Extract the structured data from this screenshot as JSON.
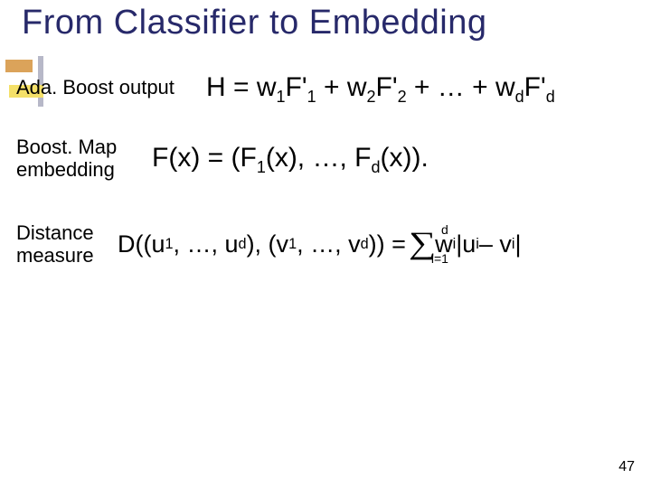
{
  "slide": {
    "title": "From Classifier to Embedding",
    "page_number": "47"
  },
  "rows": {
    "adaboost": {
      "label": "Ada. Boost output"
    },
    "boostmap": {
      "label_line1": "Boost. Map",
      "label_line2": "embedding"
    },
    "distance": {
      "label_line1": "Distance",
      "label_line2": "measure"
    }
  },
  "formulas": {
    "H_lhs": "H = ",
    "H_t1a": "w",
    "H_t1b": "F'",
    "H_plus": " + ",
    "H_dots": " + … + ",
    "F_lhs": "F(x) = (F",
    "F_mid": "(x), …, F",
    "F_rhs": "(x)).",
    "D_lhs": "D((u",
    "D_p2": ", …, u",
    "D_p3": "), (v",
    "D_p4": ", …, v",
    "D_p5": ")) = ",
    "D_tail_w": "w",
    "D_tail_u": "|u",
    "D_tail_v": " – v",
    "D_tail_end": "|"
  },
  "subs": {
    "one": "1",
    "two": "2",
    "d": "d",
    "i": "i",
    "ieq1": "i=1"
  },
  "sigma": "∑",
  "chart_data": null
}
